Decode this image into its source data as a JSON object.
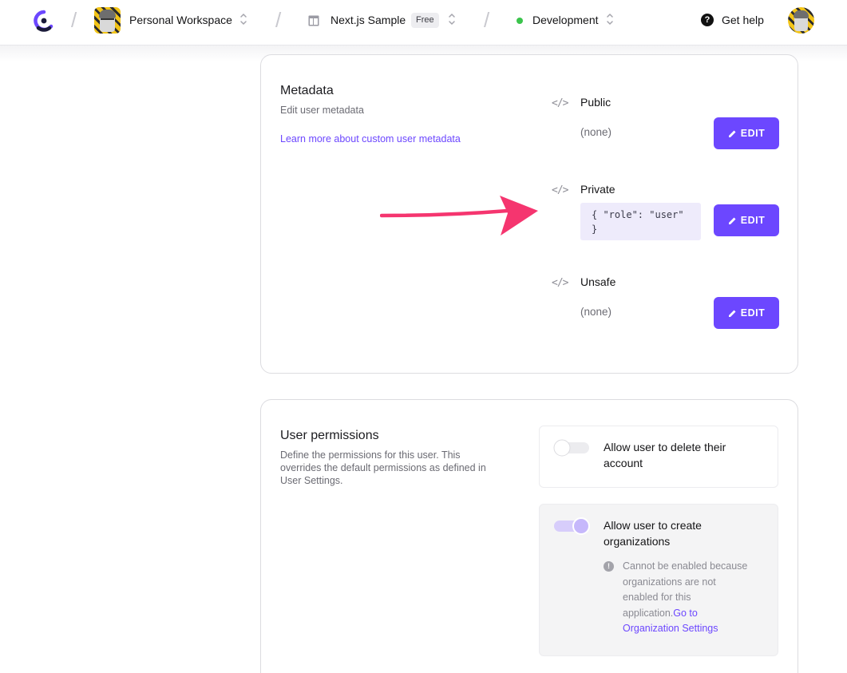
{
  "topbar": {
    "workspace_name": "Personal Workspace",
    "project_name": "Next.js Sample",
    "project_plan": "Free",
    "environment": "Development",
    "help_label": "Get help"
  },
  "metadata": {
    "title": "Metadata",
    "subtitle": "Edit user metadata",
    "learn_more": "Learn more about custom user metadata",
    "public_label": "Public",
    "public_value": "(none)",
    "private_label": "Private",
    "private_value_line1": "{ \"role\": \"user\"",
    "private_value_line2": "}",
    "unsafe_label": "Unsafe",
    "unsafe_value": "(none)",
    "edit_label": "EDIT"
  },
  "permissions": {
    "title": "User permissions",
    "subtitle_line1": "Define the permissions for this user. This",
    "subtitle_line2": "overrides the default permissions as defined in",
    "subtitle_line3": "User Settings.",
    "delete_line1": "Allow user to delete their",
    "delete_line2": "account",
    "delete_enabled": false,
    "orgs_line1": "Allow user to create",
    "orgs_line2": "organizations",
    "orgs_enabled": true,
    "orgs_disabled": true,
    "note_line1": "Cannot be enabled because",
    "note_line2": "organizations are not",
    "note_line3": "enabled for this",
    "note_line4": "application.",
    "note_link_line1": "Go to",
    "note_link_line2": "Organization Settings"
  },
  "colors": {
    "accent": "#6c47ff",
    "status_green": "#3bc44c",
    "arrow": "#f5356f"
  }
}
